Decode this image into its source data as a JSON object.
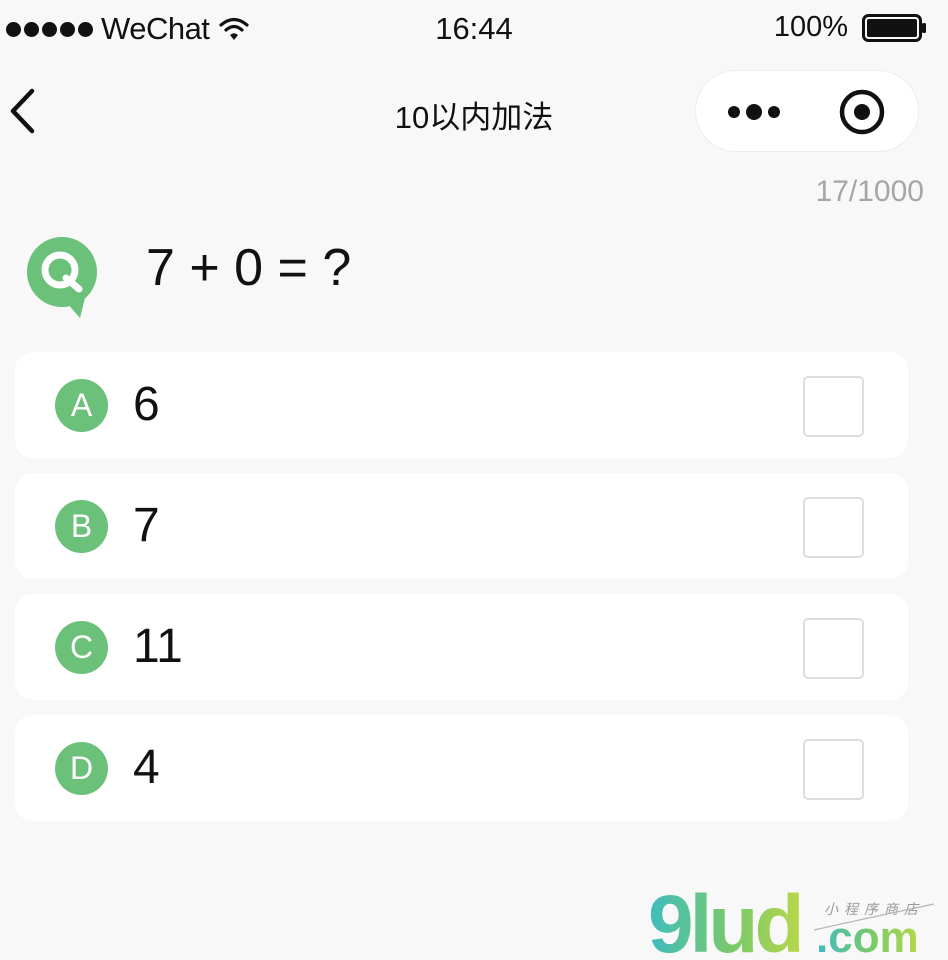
{
  "status_bar": {
    "carrier": "WeChat",
    "time": "16:44",
    "battery": "100%"
  },
  "nav": {
    "title": "10以内加法"
  },
  "quiz": {
    "progress": "17/1000",
    "question": "7 + 0 = ?",
    "options": [
      {
        "letter": "A",
        "value": "6"
      },
      {
        "letter": "B",
        "value": "7"
      },
      {
        "letter": "C",
        "value": "11"
      },
      {
        "letter": "D",
        "value": "4"
      }
    ]
  },
  "watermark": {
    "logo_text": "9lud.com",
    "tagline": "小程序商店"
  },
  "colors": {
    "accent_green": "#6cc17a",
    "background": "#f8f8f8",
    "card": "#ffffff",
    "muted_text": "#a6a6a6"
  },
  "icons": [
    "signal-dots-icon",
    "wifi-icon",
    "battery-icon",
    "back-arrow-icon",
    "more-dots-icon",
    "close-target-icon",
    "question-badge-icon",
    "checkbox-icon"
  ]
}
